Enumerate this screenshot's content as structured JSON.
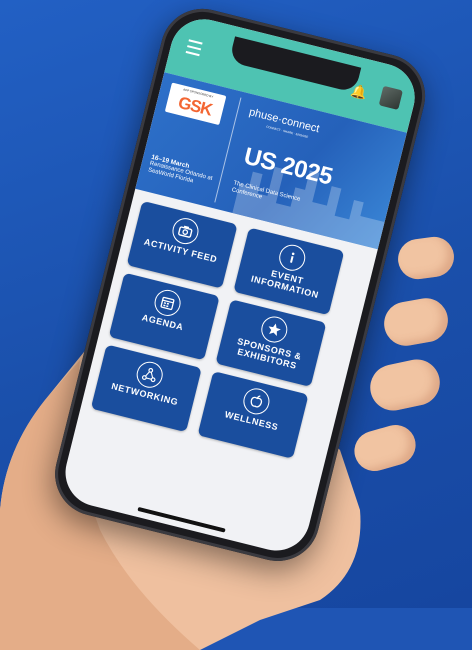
{
  "app": {
    "bell_icon": "bell-icon",
    "menu_icon": "menu-icon"
  },
  "banner": {
    "sponsor_label": "APP SPONSORED BY",
    "sponsor_name": "GSK",
    "brand": "phuse·connect",
    "brand_sub": "CONNECT · SHARE · ENGAGE",
    "edition": "US 2025",
    "subtitle": "The Clinical Data Science Conference",
    "date_line": "16–19 March",
    "venue": "Renaissance Orlando at SeaWorld Florida"
  },
  "tiles": [
    {
      "label": "ACTIVITY FEED",
      "icon": "camera-icon"
    },
    {
      "label": "EVENT INFORMATION",
      "icon": "info-icon"
    },
    {
      "label": "AGENDA",
      "icon": "calendar-icon"
    },
    {
      "label": "SPONSORS & EXHIBITORS",
      "icon": "star-icon"
    },
    {
      "label": "NETWORKING",
      "icon": "network-icon"
    },
    {
      "label": "WELLNESS",
      "icon": "apple-icon"
    }
  ],
  "colors": {
    "background": "#1f55b4",
    "topbar": "#4ec3b2",
    "tile": "#1a4e9e",
    "sponsor_accent": "#f36633"
  }
}
